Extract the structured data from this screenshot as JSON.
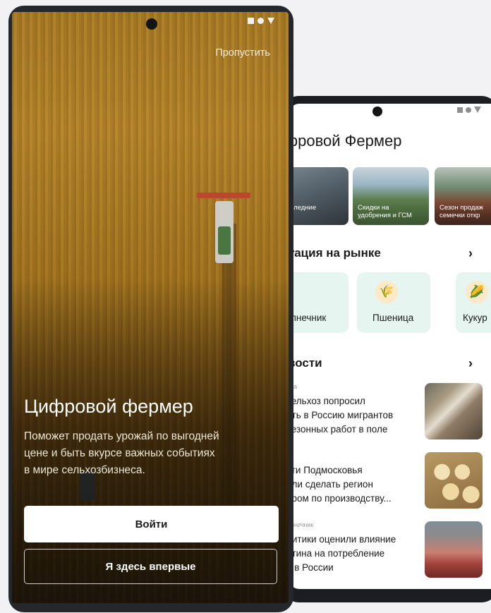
{
  "front": {
    "skip_label": "Пропустить",
    "title": "Цифровой фермер",
    "description": "Поможет продать урожай по выгодней\nцене и быть вкурсе важных событиях\nв мире сельхозбизнеса.",
    "login_label": "Войти",
    "new_user_label": "Я здесь впервые"
  },
  "back": {
    "app_title": "фровой Фермер",
    "stories": [
      {
        "caption": "и последние\nтки"
      },
      {
        "caption": "Скидки на\nудобрения и ГСМ"
      },
      {
        "caption": "Сезон продаж\nсемечки откр"
      }
    ],
    "market": {
      "title": "уация на рынке",
      "crops": [
        {
          "label": "дсолнечник",
          "icon": "sunflower-icon"
        },
        {
          "label": "Пшеница",
          "icon": "wheat-icon"
        },
        {
          "label": "Кукур",
          "icon": "corn-icon"
        }
      ]
    },
    "news": {
      "title": "вости",
      "items": [
        {
          "category": "ица",
          "headline": "сельхоз попросил\nить в Россию мигрантов\nсезонных работ в поле"
        },
        {
          "category": "",
          "headline": "сти Подмосковья\nили сделать регион\nером по производству..."
        },
        {
          "category": "олнечник",
          "headline": "литики оценили влияние\nнтина на потребление\nа в России"
        }
      ]
    }
  },
  "colors": {
    "crop_card_bg": "#e6f5ef",
    "button_bg": "#ffffff"
  }
}
